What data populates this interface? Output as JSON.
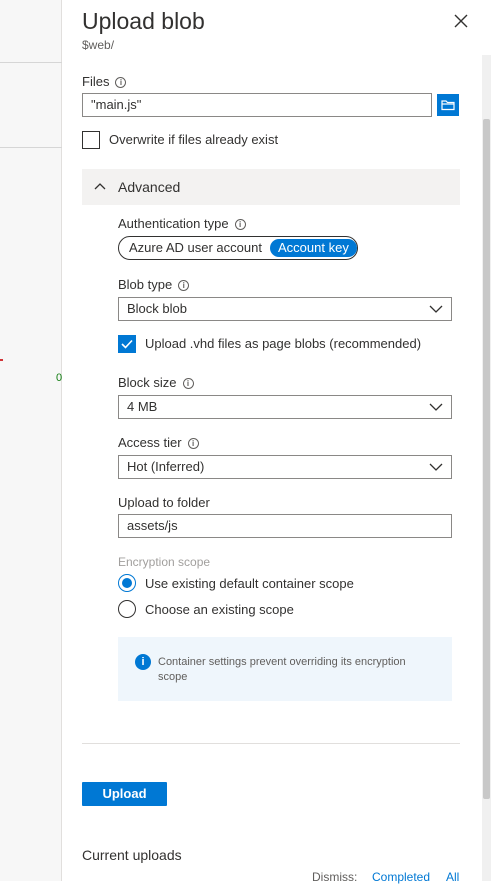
{
  "panel": {
    "title": "Upload blob",
    "subtitle": "$web/"
  },
  "files": {
    "label": "Files",
    "value": "\"main.js\""
  },
  "overwrite": {
    "label": "Overwrite if files already exist",
    "checked": false
  },
  "advanced": {
    "label": "Advanced",
    "expanded": true
  },
  "auth": {
    "label": "Authentication type",
    "options": [
      "Azure AD user account",
      "Account key"
    ],
    "selected": "Account key"
  },
  "blob_type": {
    "label": "Blob type",
    "value": "Block blob"
  },
  "vhd": {
    "label": "Upload .vhd files as page blobs (recommended)",
    "checked": true
  },
  "block_size": {
    "label": "Block size",
    "value": "4 MB"
  },
  "access_tier": {
    "label": "Access tier",
    "value": "Hot (Inferred)"
  },
  "upload_folder": {
    "label": "Upload to folder",
    "value": "assets/js"
  },
  "encryption": {
    "label": "Encryption scope",
    "options": [
      "Use existing default container scope",
      "Choose an existing scope"
    ],
    "selected": "Use existing default container scope",
    "info_line1": "Container settings prevent overriding its encryption",
    "info_line2": "scope"
  },
  "actions": {
    "upload_label": "Upload"
  },
  "current_uploads": {
    "label": "Current uploads",
    "dismiss_label": "Dismiss:",
    "completed_label": "Completed",
    "all_label": "All"
  },
  "colors": {
    "accent": "#0078d4",
    "info_bg": "#eff6fc"
  }
}
